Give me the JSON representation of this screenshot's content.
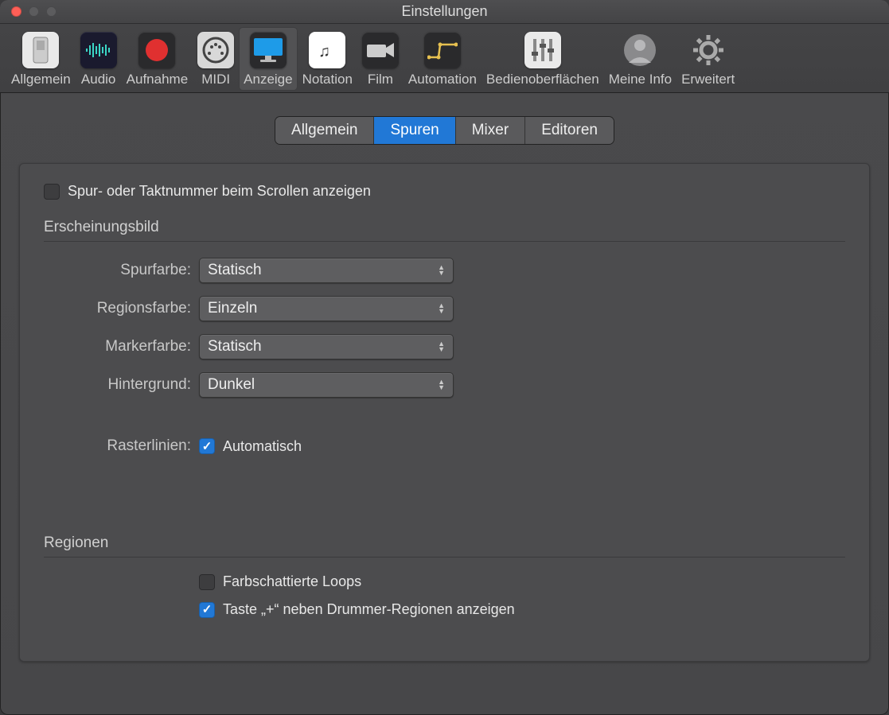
{
  "window": {
    "title": "Einstellungen"
  },
  "toolbar": [
    {
      "id": "general",
      "label": "Allgemein",
      "icon": "switch",
      "bg": "#e9e9e9",
      "active": false
    },
    {
      "id": "audio",
      "label": "Audio",
      "icon": "wave",
      "bg": "#1a1a2e",
      "active": false
    },
    {
      "id": "record",
      "label": "Aufnahme",
      "icon": "rec",
      "bg": "#2a2a2c",
      "active": false
    },
    {
      "id": "midi",
      "label": "MIDI",
      "icon": "din",
      "bg": "#d8d8d8",
      "active": false
    },
    {
      "id": "display",
      "label": "Anzeige",
      "icon": "monitor",
      "bg": "#2a2a2c",
      "active": true
    },
    {
      "id": "notation",
      "label": "Notation",
      "icon": "note",
      "bg": "#ffffff",
      "active": false
    },
    {
      "id": "film",
      "label": "Film",
      "icon": "camera",
      "bg": "#2a2a2c",
      "active": false
    },
    {
      "id": "automation",
      "label": "Automation",
      "icon": "curve",
      "bg": "#2a2a2c",
      "active": false
    },
    {
      "id": "surfaces",
      "label": "Bedienoberflächen",
      "icon": "sliders",
      "bg": "#e9e9e9",
      "active": false
    },
    {
      "id": "myinfo",
      "label": "Meine Info",
      "icon": "avatar",
      "bg": "transparent",
      "active": false
    },
    {
      "id": "advanced",
      "label": "Erweitert",
      "icon": "gear",
      "bg": "transparent",
      "active": false
    }
  ],
  "tabs": [
    {
      "id": "general",
      "label": "Allgemein",
      "active": false
    },
    {
      "id": "tracks",
      "label": "Spuren",
      "active": true
    },
    {
      "id": "mixer",
      "label": "Mixer",
      "active": false
    },
    {
      "id": "editors",
      "label": "Editoren",
      "active": false
    }
  ],
  "top_checkbox": {
    "label": "Spur- oder Taktnummer beim Scrollen anzeigen",
    "checked": false
  },
  "sections": {
    "appearance": {
      "title": "Erscheinungsbild",
      "fields": {
        "track_color": {
          "label": "Spurfarbe:",
          "value": "Statisch"
        },
        "region_color": {
          "label": "Regionsfarbe:",
          "value": "Einzeln"
        },
        "marker_color": {
          "label": "Markerfarbe:",
          "value": "Statisch"
        },
        "background": {
          "label": "Hintergrund:",
          "value": "Dunkel"
        }
      },
      "gridlines": {
        "label": "Rasterlinien:",
        "value_label": "Automatisch",
        "checked": true
      }
    },
    "regions": {
      "title": "Regionen",
      "checks": [
        {
          "id": "shaded_loops",
          "label": "Farbschattierte Loops",
          "checked": false
        },
        {
          "id": "plus_drummer",
          "label": "Taste „+“ neben Drummer-Regionen anzeigen",
          "checked": true
        }
      ]
    }
  }
}
